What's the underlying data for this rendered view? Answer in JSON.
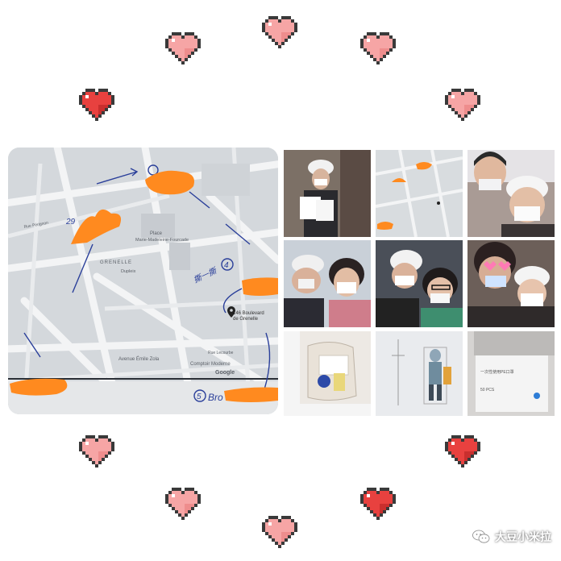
{
  "map": {
    "labels": {
      "place": "Place",
      "square": "Marie-Madeleine-Fourcade",
      "district": "GRENELLE",
      "metro1": "Dupleix",
      "address1": "146 Boulevard",
      "address2": "de Grenelle",
      "avenue": "Avenue Émile Zola",
      "shop": "Comptoir Moderne",
      "brand": "Google",
      "rue1": "Rue Pérignon",
      "rue2": "Rue Lecourbe"
    },
    "handwriting": {
      "n29": "29",
      "n4": "4",
      "n5": "5",
      "bro": "Bro",
      "chinese": "撕一撕"
    }
  },
  "colors": {
    "orange_scribble": "#ff8a1f",
    "heart_light": "#f6a5a5",
    "heart_dark": "#e8413f",
    "map_bg": "#d7dadd"
  },
  "watermark": {
    "text": "大豆小米拉",
    "icon": "wechat-icon"
  },
  "tiles": [
    {
      "name": "photo-helmet-documents"
    },
    {
      "name": "photo-map-small"
    },
    {
      "name": "photo-selfie-helmets"
    },
    {
      "name": "photo-group-masks"
    },
    {
      "name": "photo-selfie-glasses"
    },
    {
      "name": "photo-selfie-heart-eyes"
    },
    {
      "name": "photo-bag-supplies"
    },
    {
      "name": "photo-drawing"
    },
    {
      "name": "photo-mask-box"
    }
  ],
  "box_text": {
    "line1": "一次性使用PE口罩",
    "line2": "50 PCS"
  }
}
